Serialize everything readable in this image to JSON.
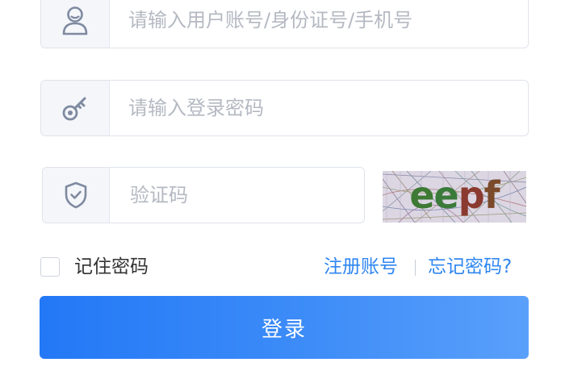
{
  "form": {
    "username": {
      "placeholder": "请输入用户账号/身份证号/手机号",
      "value": "",
      "icon": "user-icon"
    },
    "password": {
      "placeholder": "请输入登录密码",
      "value": "",
      "icon": "key-icon"
    },
    "captcha": {
      "placeholder": "验证码",
      "value": "",
      "icon": "shield-check-icon",
      "image_text": "eepf"
    },
    "remember": {
      "label": "记住密码",
      "checked": false
    },
    "register_link": "注册账号",
    "forgot_link": "忘记密码?",
    "login_button": "登录"
  },
  "colors": {
    "accent": "#2f86f0",
    "button_start": "#2378f6",
    "button_end": "#5aa0fb",
    "icon": "#7f8aa0",
    "field_border": "#dfe3ea",
    "icon_background": "#f4f6fa"
  }
}
